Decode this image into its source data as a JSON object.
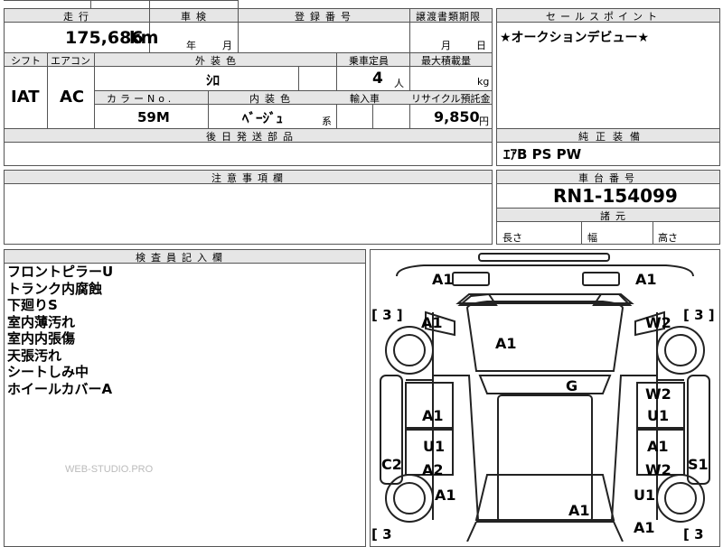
{
  "header": {
    "mileage_label": "走行",
    "inspection_label": "車検",
    "registration_label": "登録番号",
    "transfer_date_label": "譲渡書類期限",
    "sales_point_label": "セールスポイント",
    "mileage_value": "175,686",
    "mileage_unit": "km",
    "year_unit": "年",
    "month_unit": "月",
    "transfer_month_unit": "月",
    "transfer_day_unit": "日",
    "sales_point_text": "★オークションデビュー★"
  },
  "spec": {
    "shift_label": "シフト",
    "aircon_label": "エアコン",
    "exterior_color_label": "外装色",
    "capacity_label": "乗車定員",
    "max_load_label": "最大積載量",
    "shift_value": "IAT",
    "aircon_value": "AC",
    "exterior_color_value": "ｼﾛ",
    "capacity_value": "4",
    "capacity_unit": "人",
    "load_unit": "kg",
    "color_no_label": "カラーNo.",
    "interior_color_label": "内装色",
    "import_label": "輸入車",
    "recycle_label": "リサイクル預託金",
    "color_no_value": "59M",
    "interior_color_value": "ﾍﾞｰｼﾞｭ",
    "interior_color_suffix": "系",
    "recycle_value": "9,850",
    "recycle_unit": "円",
    "later_parts_label": "後日発送部品"
  },
  "equipment": {
    "label": "純正装備",
    "value": "ｴｱB PS PW"
  },
  "notes": {
    "label": "注意事項欄"
  },
  "chassis": {
    "label": "車台番号",
    "value": "RN1-154099",
    "dimensions_label": "諸元",
    "length_label": "長さ",
    "width_label": "幅",
    "height_label": "高さ"
  },
  "inspector": {
    "label": "検査員記入欄",
    "lines": [
      "フロントピラーU",
      "トランク内腐蝕",
      "下廻りS",
      "室内薄汚れ",
      "室内内張傷",
      "天張汚れ",
      "シートしみ中",
      "ホイールカバーA"
    ],
    "watermark": "WEB-STUDIO.PRO"
  },
  "damage_map": {
    "bracket_tl": "[ 3 ]",
    "bracket_tr": "[ 3 ]",
    "bracket_bl": "[ 3",
    "bracket_br": "[ 3",
    "marks": {
      "front_left": "A1",
      "front_right": "A1",
      "left_front_fender": "A1",
      "right_front_fender": "W2",
      "hood": "A1",
      "roof": "G",
      "left_front_door": "A1",
      "right_front_door_a": "W2",
      "right_front_door_b": "U1",
      "left_rear_door_a": "U1",
      "left_rear_door_b": "A2",
      "right_rear_door_a": "A1",
      "right_rear_door_b": "W2",
      "left_sill": "C2",
      "right_sill": "S1",
      "left_rear_fender": "A1",
      "right_rear_fender": "U1",
      "trunk": "A1",
      "rear_right": "A1"
    }
  }
}
